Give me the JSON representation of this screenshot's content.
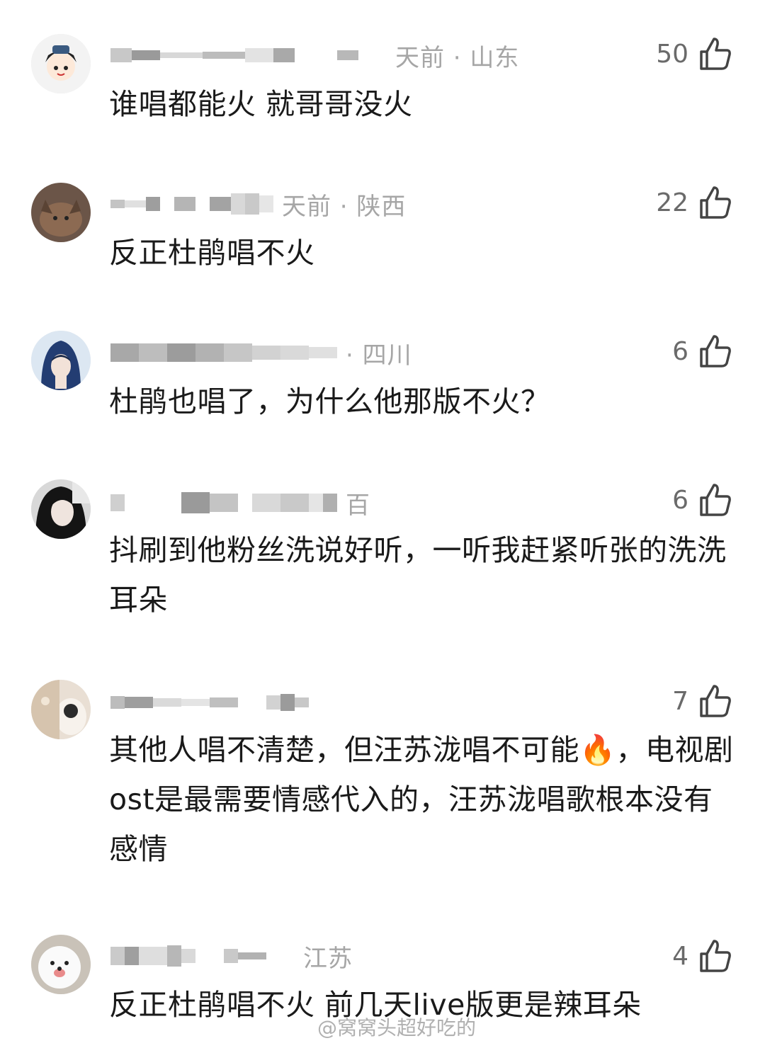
{
  "comments": [
    {
      "meta": "天前 · 山东",
      "likes": "50",
      "text": "谁唱都能火 就哥哥没火"
    },
    {
      "meta": "天前 · 陕西",
      "likes": "22",
      "text": "反正杜鹃唱不火"
    },
    {
      "meta": "· 四川",
      "likes": "6",
      "text": "杜鹃也唱了，为什么他那版不火？"
    },
    {
      "meta": "百",
      "likes": "6",
      "text": "抖刷到他粉丝洗说好听，一听我赶紧听张的洗洗耳朵"
    },
    {
      "meta": "",
      "likes": "7",
      "text": "其他人唱不清楚，但汪苏泷唱不可能🔥，电视剧ost是最需要情感代入的，汪苏泷唱歌根本没有感情"
    },
    {
      "meta": "江苏",
      "likes": "4",
      "text": "反正杜鹃唱不火 前几天live版更是辣耳朵"
    }
  ],
  "watermark": "@窝窝头超好吃的",
  "icons": {
    "like": "thumbs-up-icon"
  }
}
